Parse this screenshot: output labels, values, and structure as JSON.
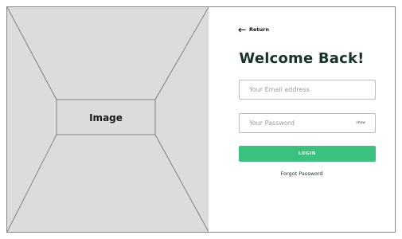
{
  "image_panel": {
    "placeholder_label": "Image"
  },
  "form": {
    "return_label": "Return",
    "title": "Welcome Back!",
    "email_placeholder": "Your Email address",
    "password_placeholder": "Your Password",
    "show_label": "show",
    "login_label": "LOGIN",
    "forgot_label": "Forgot Password"
  },
  "colors": {
    "accent": "#3cc07f",
    "title_text": "#18332b",
    "image_placeholder_bg": "#dcdcdc"
  }
}
